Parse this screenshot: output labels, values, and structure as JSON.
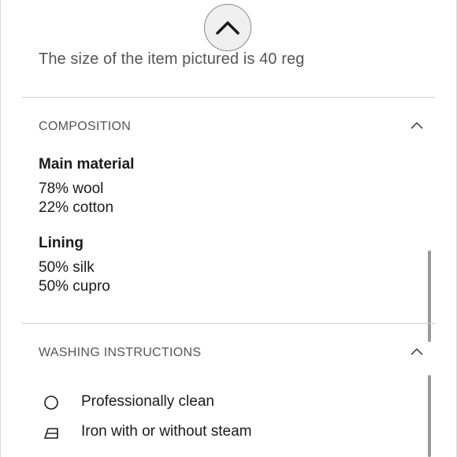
{
  "size_note": "The size of the item pictured is 40 reg",
  "composition": {
    "title": "COMPOSITION",
    "groups": [
      {
        "title": "Main material",
        "lines": [
          "78% wool",
          "22% cotton"
        ]
      },
      {
        "title": "Lining",
        "lines": [
          "50% silk",
          "50% cupro"
        ]
      }
    ]
  },
  "washing": {
    "title": "WASHING INSTRUCTIONS",
    "items": [
      {
        "icon": "professional-clean-circle-icon",
        "label": "Professionally clean"
      },
      {
        "icon": "iron-icon",
        "label": "Iron with or without steam"
      }
    ]
  }
}
